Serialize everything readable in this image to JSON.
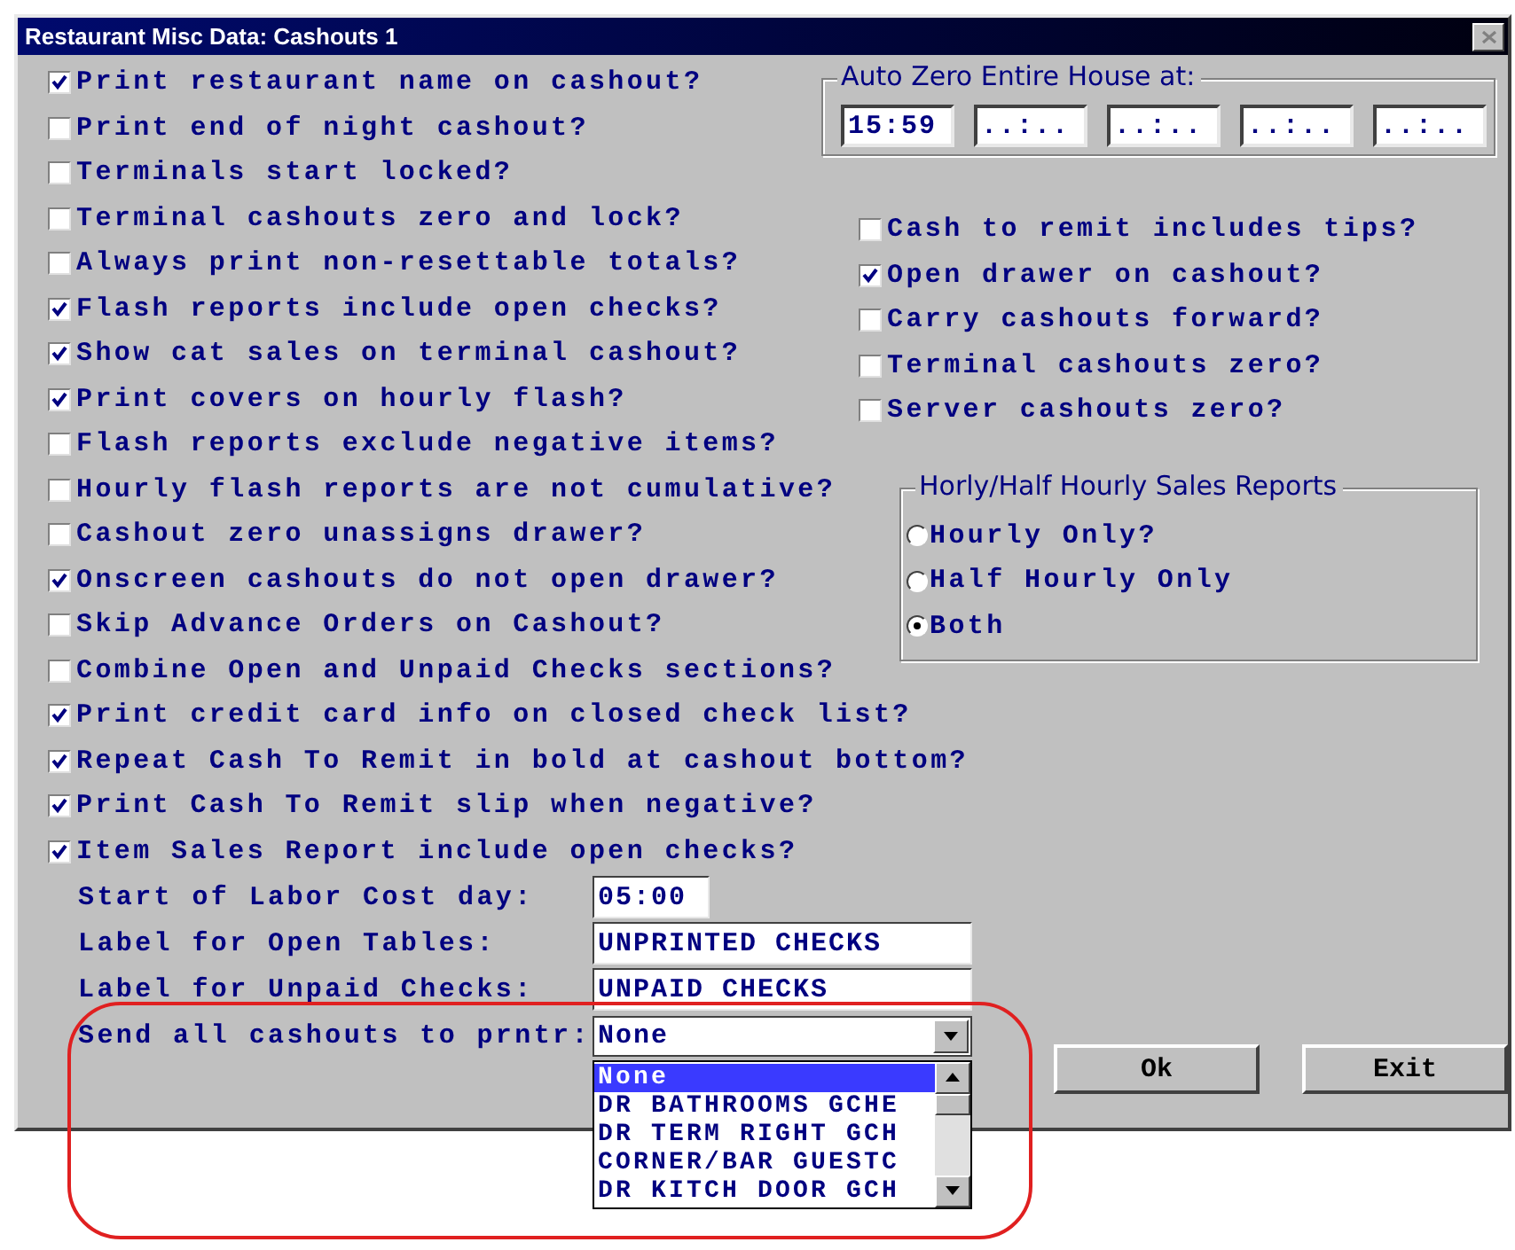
{
  "window": {
    "title": "Restaurant Misc Data: Cashouts 1"
  },
  "left_options": [
    {
      "label": "Print restaurant name on cashout?",
      "checked": true
    },
    {
      "label": "Print end of night cashout?",
      "checked": false
    },
    {
      "label": "Terminals start locked?",
      "checked": false
    },
    {
      "label": "Terminal cashouts zero and lock?",
      "checked": false
    },
    {
      "label": "Always print non-resettable totals?",
      "checked": false
    },
    {
      "label": "Flash reports include open checks?",
      "checked": true
    },
    {
      "label": "Show cat sales on terminal cashout?",
      "checked": true
    },
    {
      "label": "Print covers on hourly flash?",
      "checked": true
    },
    {
      "label": "Flash reports exclude negative items?",
      "checked": false
    },
    {
      "label": "Hourly flash reports are not cumulative?",
      "checked": false
    },
    {
      "label": "Cashout zero unassigns drawer?",
      "checked": false
    },
    {
      "label": "Onscreen cashouts do not open drawer?",
      "checked": true
    },
    {
      "label": "Skip Advance Orders on Cashout?",
      "checked": false
    },
    {
      "label": "Combine Open and Unpaid Checks sections?",
      "checked": false
    },
    {
      "label": "Print credit card info on closed check list?",
      "checked": true
    },
    {
      "label": "Repeat Cash To Remit in bold at cashout bottom?",
      "checked": true
    },
    {
      "label": "Print Cash To Remit slip when negative?",
      "checked": true
    },
    {
      "label": "Item Sales Report include open checks?",
      "checked": true
    }
  ],
  "auto_zero": {
    "title": "Auto Zero Entire House at:",
    "times": [
      "15:59",
      "..:..",
      "..:..",
      "..:..",
      "..:.."
    ]
  },
  "right_options": [
    {
      "label": "Cash to remit includes tips?",
      "checked": false
    },
    {
      "label": "Open drawer on cashout?",
      "checked": true
    },
    {
      "label": "Carry cashouts forward?",
      "checked": false
    },
    {
      "label": "Terminal cashouts zero?",
      "checked": false
    },
    {
      "label": "Server cashouts zero?",
      "checked": false
    }
  ],
  "sales_reports": {
    "title": "Horly/Half Hourly Sales Reports",
    "options": [
      {
        "label": "Hourly Only?",
        "selected": false
      },
      {
        "label": "Half Hourly Only",
        "selected": false
      },
      {
        "label": "Both",
        "selected": true
      }
    ]
  },
  "fields": [
    {
      "label": "Start of Labor Cost day:",
      "value": "05:00",
      "kind": "short"
    },
    {
      "label": "Label for Open Tables:",
      "value": "UNPRINTED CHECKS",
      "kind": "text"
    },
    {
      "label": "Label for Unpaid Checks:",
      "value": "UNPAID CHECKS",
      "kind": "text"
    },
    {
      "label": "Send all cashouts to prntr:",
      "value": "None",
      "kind": "dropdown",
      "options": [
        {
          "label": "None",
          "selected": true
        },
        {
          "label": "DR BATHROOMS GCHE",
          "selected": false
        },
        {
          "label": "DR TERM RIGHT GCH",
          "selected": false
        },
        {
          "label": "CORNER/BAR GUESTC",
          "selected": false
        },
        {
          "label": "DR KITCH DOOR GCH",
          "selected": false
        }
      ]
    }
  ],
  "buttons": [
    {
      "label": "Ok"
    },
    {
      "label": "Exit"
    }
  ]
}
